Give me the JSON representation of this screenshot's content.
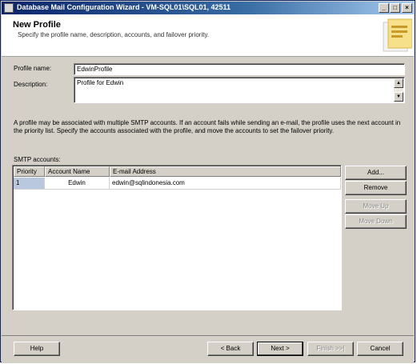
{
  "window": {
    "title": "Database Mail Configuration Wizard - VM-SQL01\\SQL01, 42511",
    "controls": {
      "minimize": "_",
      "maximize": "□",
      "close": "×"
    }
  },
  "header": {
    "title": "New Profile",
    "subtitle": "Specify the profile name, description, accounts, and failover priority."
  },
  "form": {
    "profile_name_label": "Profile name:",
    "profile_name_value": "EdwinProfile",
    "description_label": "Description:",
    "description_value": "Profile for Edwin"
  },
  "info_text": "A profile may be associated with multiple SMTP accounts. If an account fails while sending an e-mail, the profile uses the next account in the priority list. Specify the accounts associated with the profile, and move the accounts to set the failover priority.",
  "smtp": {
    "label": "SMTP accounts:",
    "columns": [
      "Priority",
      "Account Name",
      "E-mail Address"
    ],
    "rows": [
      {
        "priority": "1",
        "account": "Edwin",
        "email": "edwin@sqlindonesia.com"
      }
    ]
  },
  "side_buttons": {
    "add": "Add...",
    "remove": "Remove",
    "move_up": "Move Up",
    "move_down": "Move Down"
  },
  "footer_buttons": {
    "help": "Help",
    "back": "< Back",
    "next": "Next >",
    "finish": "Finish >>|",
    "cancel": "Cancel"
  }
}
